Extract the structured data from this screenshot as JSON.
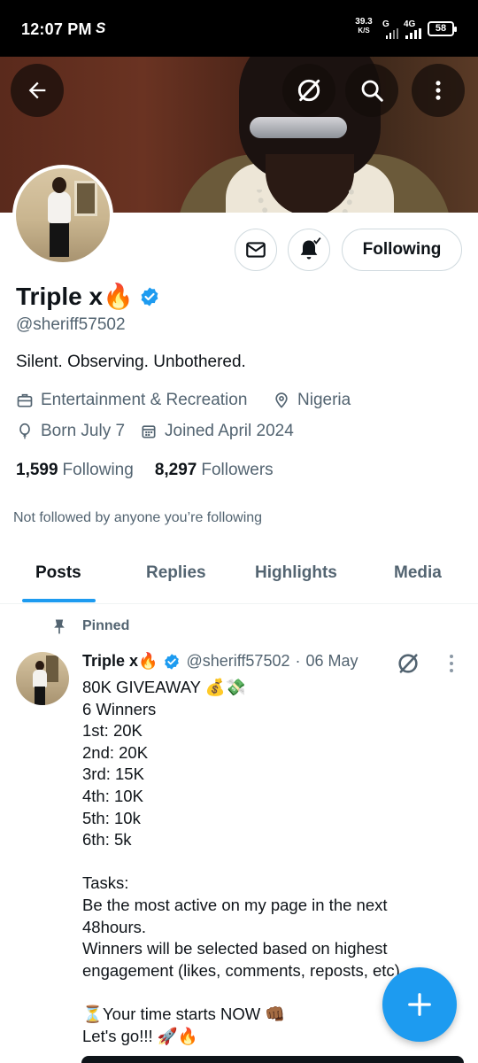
{
  "status_bar": {
    "time": "12:07 PM",
    "app_indicator": "S",
    "net_speed_value": "39.3",
    "net_speed_unit": "K/S",
    "net_type_1": "G",
    "net_type_2": "4G",
    "battery": "58"
  },
  "header_actions": {
    "back_icon": "arrow-left-icon",
    "grok_icon": "grok-icon",
    "search_icon": "search-icon",
    "more_icon": "more-vertical-icon"
  },
  "profile": {
    "display_name": "Triple x🔥",
    "handle": "@sheriff57502",
    "bio": "Silent. Observing. Unbothered.",
    "category": "Entertainment & Recreation",
    "location": "Nigeria",
    "birthday": "Born July 7",
    "joined": "Joined April 2024",
    "following_count": "1,599",
    "following_label": "Following",
    "followers_count": "8,297",
    "followers_label": "Followers",
    "not_followed_text": "Not followed by anyone you’re following",
    "follow_button_label": "Following"
  },
  "tabs": [
    {
      "label": "Posts",
      "active": true
    },
    {
      "label": "Replies",
      "active": false
    },
    {
      "label": "Highlights",
      "active": false
    },
    {
      "label": "Media",
      "active": false
    }
  ],
  "pinned_post": {
    "pinned_label": "Pinned",
    "author_name": "Triple x🔥",
    "author_handle": "@sheriff57502",
    "separator": "·",
    "date": "06 May",
    "body": "80K GIVEAWAY 💰💸\n6 Winners\n1st:  20K\n2nd: 20K\n3rd: 15K\n4th: 10K\n5th: 10k\n6th: 5k\n\nTasks:\nBe the most active on my page in the next 48hours.\nWinners will be selected based on highest engagement (likes, comments, reposts, etc)\n\n⏳Your time starts NOW 👊🏾\nLet's go!!! 🚀🔥"
  },
  "fab": {
    "icon": "plus-icon"
  },
  "colors": {
    "accent": "#1d9bf0",
    "text_primary": "#0f1419",
    "text_secondary": "#536471"
  }
}
